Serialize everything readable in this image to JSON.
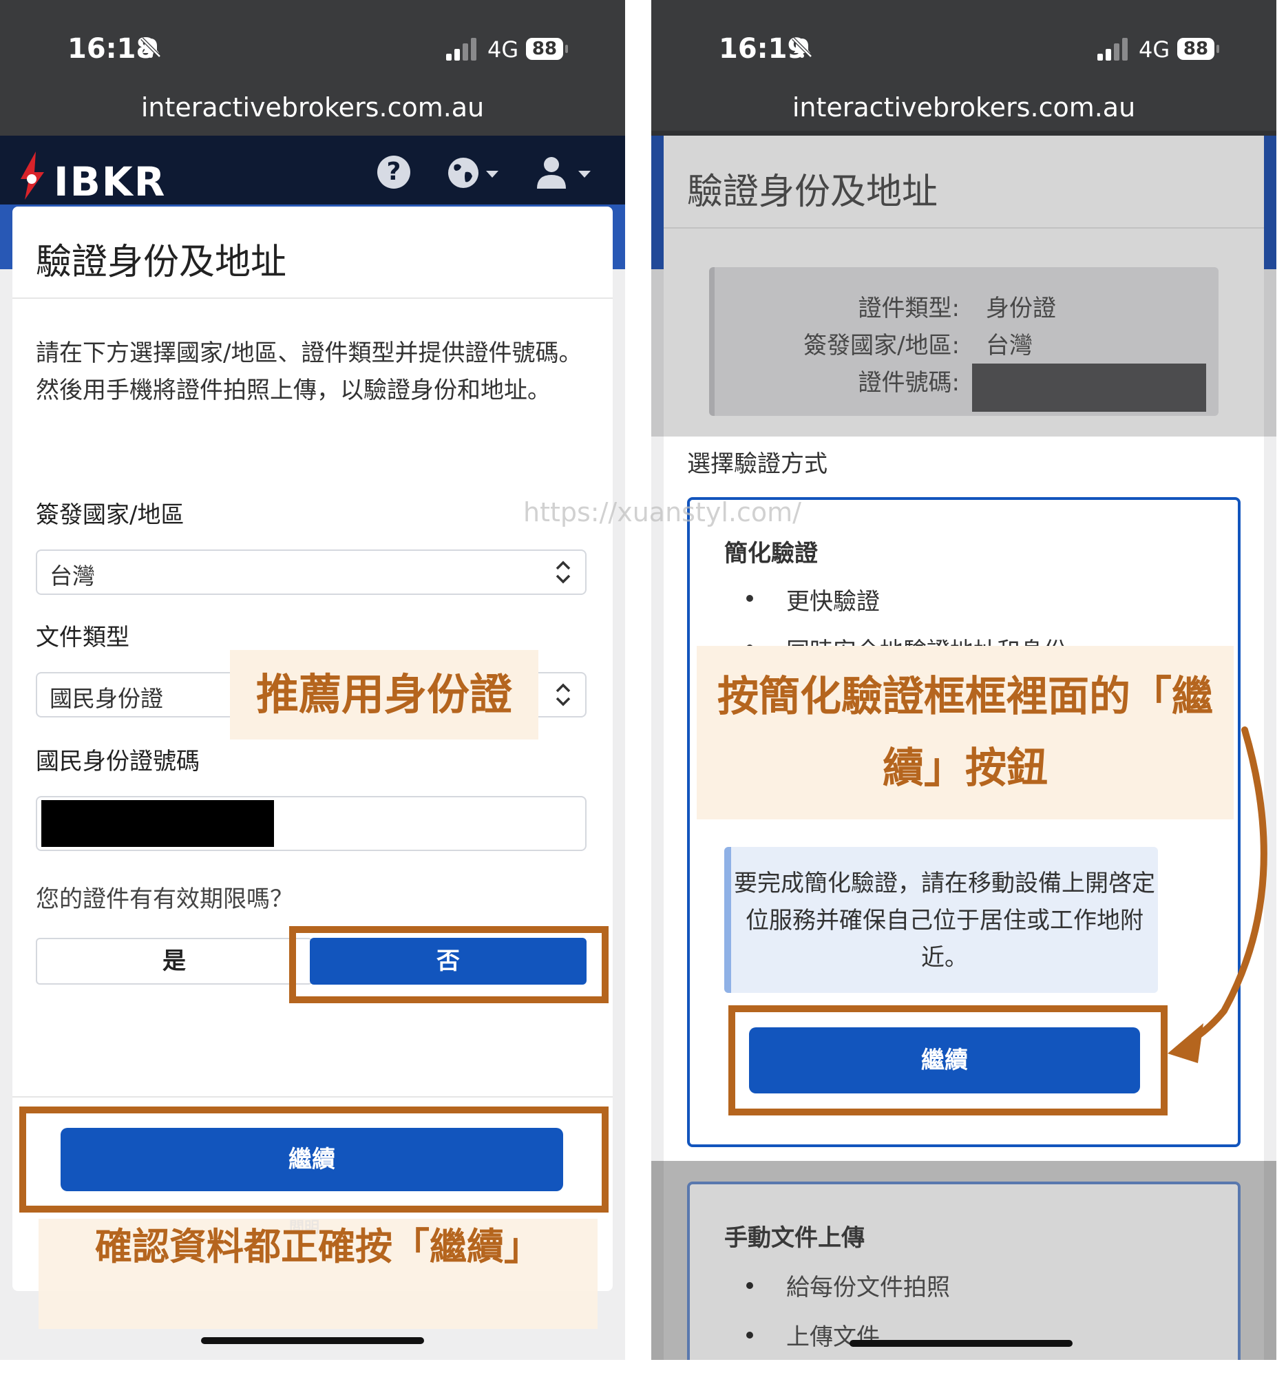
{
  "left": {
    "status": {
      "time": "16:18",
      "network": "4G",
      "battery": "88"
    },
    "url": "interactivebrokers.com.au",
    "brand": "IBKR",
    "help_glyph": "?",
    "title": "驗證身份及地址",
    "intro": "請在下方選擇國家/地區、證件類型并提供證件號碼。然後用手機將證件拍照上傳，以驗證身份和地址。",
    "country_label": "簽發國家/地區",
    "country_value": "台灣",
    "doc_type_label": "文件類型",
    "doc_type_value": "國民身份證",
    "id_number_label": "國民身份證號碼",
    "expiry_question": "您的證件有有效期限嗎？",
    "expiry_yes": "是",
    "expiry_no": "否",
    "continue": "繼續",
    "peek_text": "閲明"
  },
  "right": {
    "status": {
      "time": "16:19",
      "network": "4G",
      "battery": "88"
    },
    "url": "interactivebrokers.com.au",
    "title": "驗證身份及地址",
    "summary": [
      {
        "label": "證件類型:",
        "value": "身份證"
      },
      {
        "label": "簽發國家/地區:",
        "value": "台灣"
      },
      {
        "label": "證件號碼:",
        "value": ""
      }
    ],
    "method_heading": "選擇驗證方式",
    "simplified": {
      "title": "簡化驗證",
      "bullets": [
        "更快驗證",
        "同時安全地驗證地址和身份"
      ],
      "info": "要完成簡化驗證，請在移動設備上開啓定位服務并確保自己位于居住或工作地附近。",
      "continue": "繼續"
    },
    "manual": {
      "title": "手動文件上傳",
      "bullets": [
        "給每份文件拍照",
        "上傳文件"
      ]
    }
  },
  "annotations": {
    "recommend_id": "推薦用身份證",
    "confirm_continue": "確認資料都正確按「繼續」",
    "press_simplified": "按簡化驗證框框裡面的「繼續」按鈕",
    "watermark": "https://xuanstyl.com/"
  },
  "colors": {
    "primary": "#1255bd",
    "annotation": "#b5651e",
    "appbar": "#0e1a33",
    "statusbar": "#3a3b3d"
  },
  "icons": [
    "bell-slash-icon",
    "signal-icon",
    "battery-icon",
    "ibkr-logo-icon",
    "help-icon",
    "globe-icon",
    "user-icon",
    "chevron-updown-icon",
    "curved-arrow-icon"
  ]
}
